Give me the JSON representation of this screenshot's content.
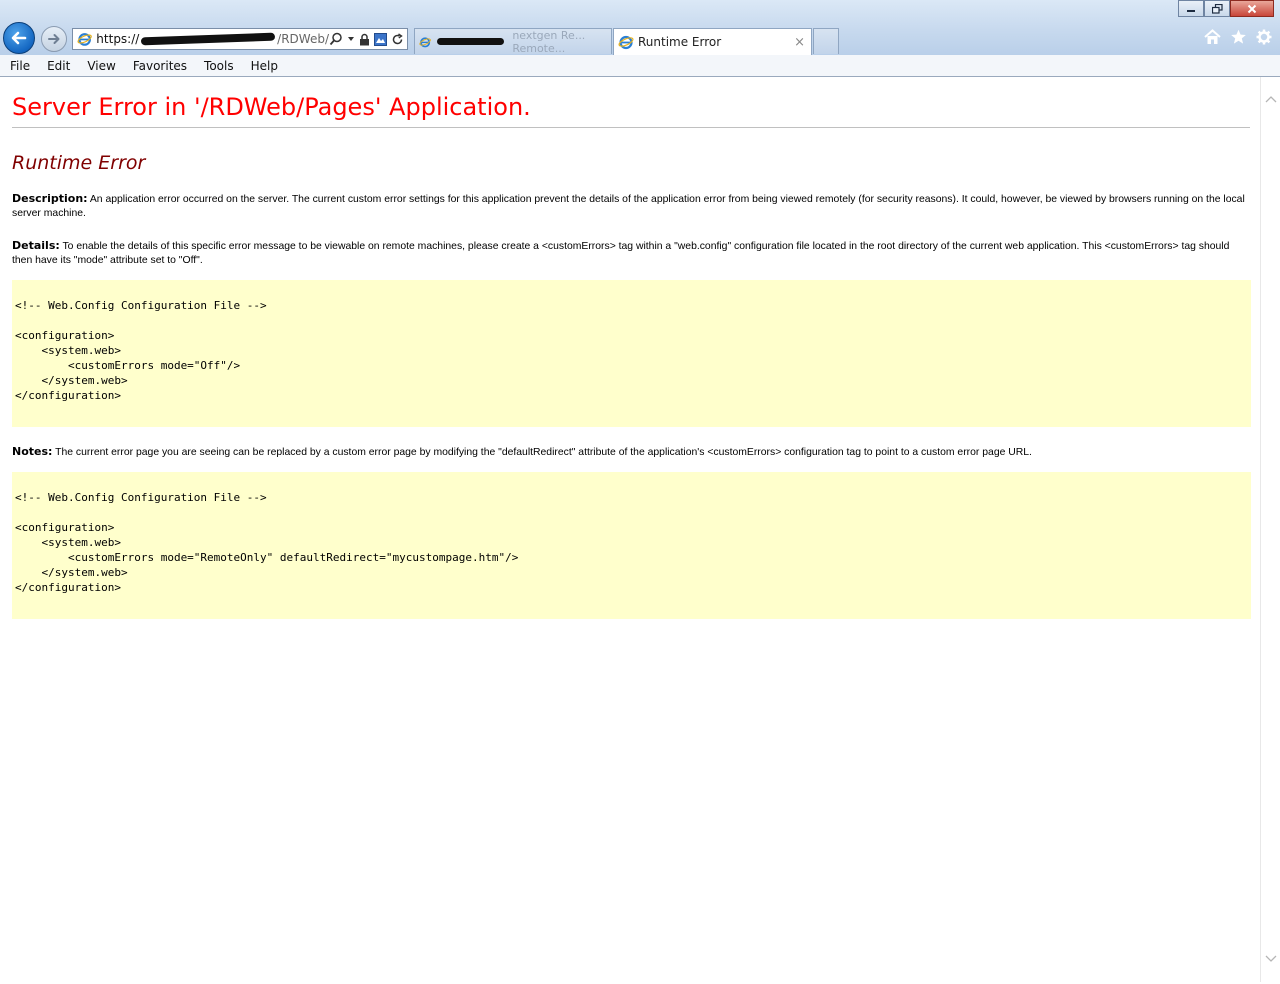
{
  "browser": {
    "address": {
      "scheme": "https://",
      "path": "/RDWeb/"
    },
    "tabs": [
      {
        "label": "",
        "faded_text": "nextgen Re... Remote..."
      },
      {
        "label": "Runtime Error",
        "close": "×"
      }
    ],
    "menu": [
      "File",
      "Edit",
      "View",
      "Favorites",
      "Tools",
      "Help"
    ],
    "icons": {
      "back": "back-arrow-icon",
      "forward": "forward-arrow-icon",
      "home": "home-icon",
      "favorites": "star-icon",
      "tools": "gear-icon"
    },
    "accent": "#1467c2"
  },
  "page": {
    "title": "Server Error in '/RDWeb/Pages' Application.",
    "subtitle": "Runtime Error",
    "description_label": "Description:",
    "description_text": " An application error occurred on the server. The current custom error settings for this application prevent the details of the application error from being viewed remotely (for security reasons). It could, however, be viewed by browsers running on the local server machine.",
    "details_label": "Details:",
    "details_text": " To enable the details of this specific error message to be viewable on remote machines, please create a <customErrors> tag within a \"web.config\" configuration file located in the root directory of the current web application. This <customErrors> tag should then have its \"mode\" attribute set to \"Off\".",
    "code1": "<!-- Web.Config Configuration File -->\n\n<configuration>\n    <system.web>\n        <customErrors mode=\"Off\"/>\n    </system.web>\n</configuration>",
    "notes_label": "Notes:",
    "notes_text": " The current error page you are seeing can be replaced by a custom error page by modifying the \"defaultRedirect\" attribute of the application's <customErrors> configuration tag to point to a custom error page URL.",
    "code2": "<!-- Web.Config Configuration File -->\n\n<configuration>\n    <system.web>\n        <customErrors mode=\"RemoteOnly\" defaultRedirect=\"mycustompage.htm\"/>\n    </system.web>\n</configuration>",
    "colors": {
      "title": "#ff0000",
      "subtitle": "#800000",
      "code_bg": "#ffffcc"
    }
  }
}
